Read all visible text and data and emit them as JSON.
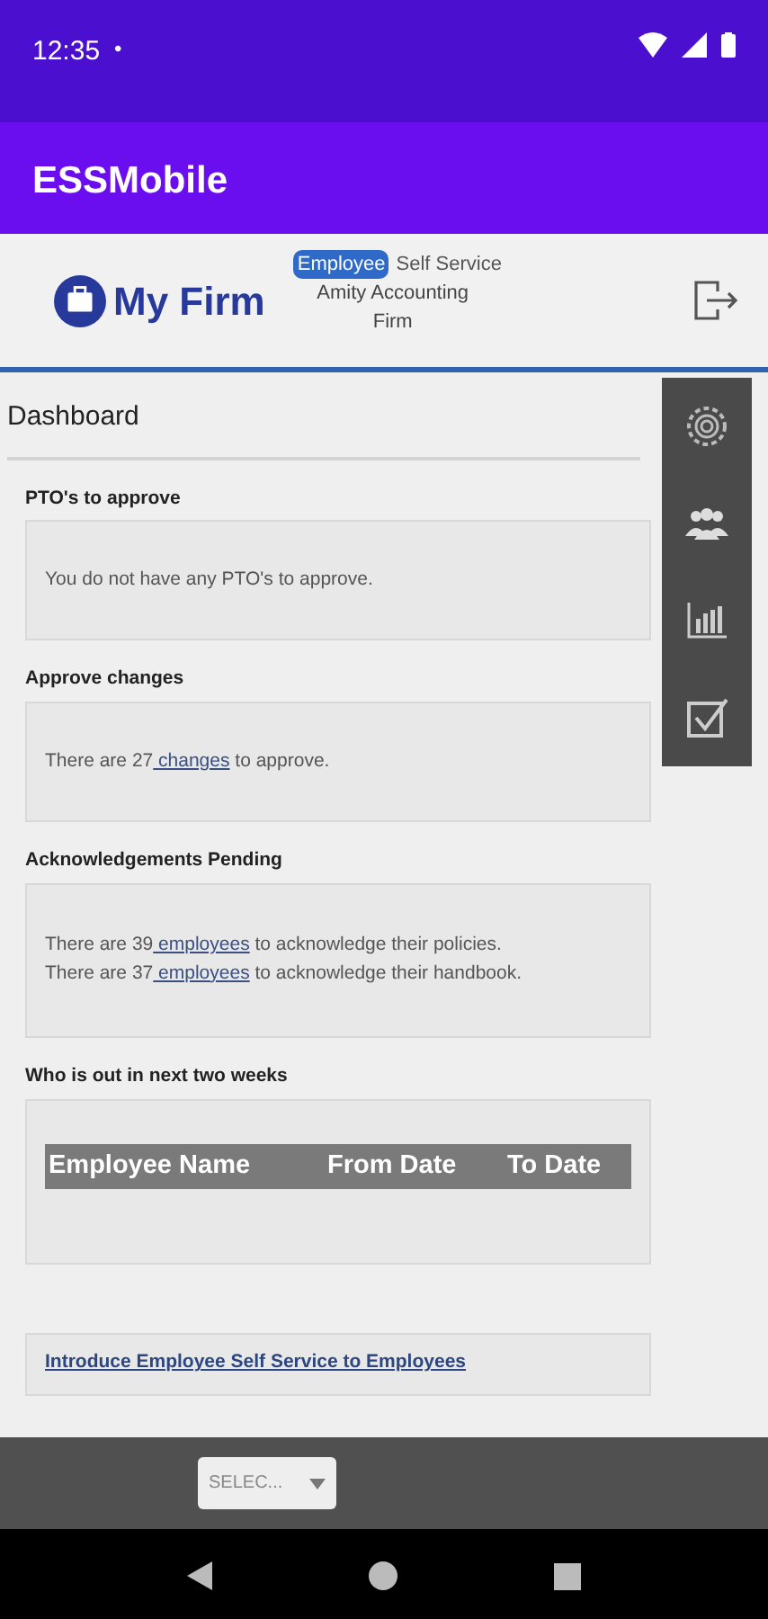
{
  "status_bar": {
    "time": "12:35",
    "dot": "•"
  },
  "app_bar": {
    "title": "ESSMobile"
  },
  "header": {
    "logo": "My Firm",
    "badge": "Employee",
    "badge_rest": "Self Service",
    "company": "Amity Accounting Firm"
  },
  "dashboard": {
    "title": "Dashboard",
    "sections": [
      {
        "kind": "text",
        "title": "PTO's to approve",
        "lines": [
          {
            "before": "You do not have any PTO's to approve."
          }
        ]
      },
      {
        "kind": "text",
        "title": "Approve changes",
        "lines": [
          {
            "before": "There are 27",
            "link": " changes",
            "after": " to approve."
          }
        ]
      },
      {
        "kind": "text",
        "title": "Acknowledgements Pending",
        "lines": [
          {
            "before": "There are 39",
            "link": " employees",
            "after": " to acknowledge their policies."
          },
          {
            "before": "There are 37",
            "link": " employees",
            "after": " to acknowledge their handbook."
          }
        ]
      },
      {
        "kind": "table",
        "title": "Who is out in next two weeks",
        "columns": [
          "Employee Name",
          "From Date",
          "To Date"
        ]
      },
      {
        "kind": "link",
        "link": "Introduce Employee Self Service to Employees"
      }
    ]
  },
  "side_menu": [
    {
      "kind": "settings"
    },
    {
      "kind": "people"
    },
    {
      "kind": "chart"
    },
    {
      "kind": "check"
    }
  ],
  "bottom_bar": {
    "select": "SELEC..."
  }
}
